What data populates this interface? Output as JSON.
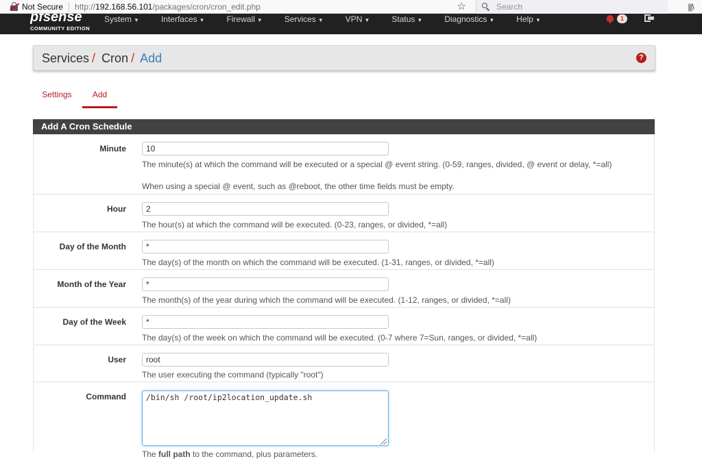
{
  "browser": {
    "not_secure": "Not Secure",
    "url_prefix": "http://",
    "url_host": "192.168.56.101",
    "url_path": "/packages/cron/cron_edit.php",
    "search_placeholder": "Search",
    "library_glyph": "|||\\"
  },
  "brand": {
    "logo_main": "pfsense",
    "logo_sub": "COMMUNITY EDITION"
  },
  "nav": {
    "items": [
      "System",
      "Interfaces",
      "Firewall",
      "Services",
      "VPN",
      "Status",
      "Diagnostics",
      "Help"
    ],
    "notification_count": "1",
    "accent": "#c9302c"
  },
  "breadcrumb": {
    "part1": "Services",
    "part2": "Cron",
    "part3": "Add",
    "help": "?"
  },
  "tabs": {
    "settings": "Settings",
    "add": "Add"
  },
  "form": {
    "heading": "Add A Cron Schedule",
    "minute": {
      "label": "Minute",
      "value": "10",
      "help1": "The minute(s) at which the command will be executed or a special @ event string. (0-59, ranges, divided, @ event or delay, *=all)",
      "help2": "When using a special @ event, such as @reboot, the other time fields must be empty."
    },
    "hour": {
      "label": "Hour",
      "value": "2",
      "help": "The hour(s) at which the command will be executed. (0-23, ranges, or divided, *=all)"
    },
    "mday": {
      "label": "Day of the Month",
      "value": "*",
      "help": "The day(s) of the month on which the command will be executed. (1-31, ranges, or divided, *=all)"
    },
    "month": {
      "label": "Month of the Year",
      "value": "*",
      "help": "The month(s) of the year during which the command will be executed. (1-12, ranges, or divided, *=all)"
    },
    "wday": {
      "label": "Day of the Week",
      "value": "*",
      "help": "The day(s) of the week on which the command will be executed. (0-7 where 7=Sun, ranges, or divided, *=all)"
    },
    "user": {
      "label": "User",
      "value": "root",
      "help": "The user executing the command (typically \"root\")"
    },
    "command": {
      "label": "Command",
      "value": "/bin/sh /root/ip2location_update.sh",
      "help_pre": "The ",
      "help_bold": "full path",
      "help_post": " to the command, plus parameters."
    }
  }
}
